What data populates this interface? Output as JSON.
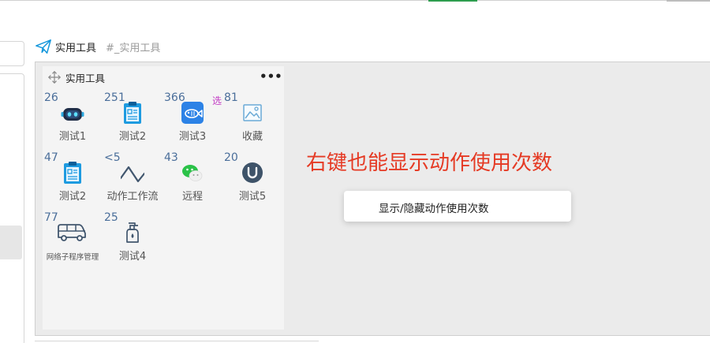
{
  "header": {
    "title": "实用工具",
    "tag": "#_实用工具",
    "icon": "paper-plane-icon"
  },
  "card": {
    "title": "实用工具",
    "more_label": "•••",
    "tiles": [
      {
        "count": "26",
        "label": "测试1",
        "icon": "robot-icon"
      },
      {
        "count": "251",
        "label": "测试2",
        "icon": "clipboard-icon"
      },
      {
        "count": "366",
        "label": "测试3",
        "icon": "fish-icon",
        "badge": "选"
      },
      {
        "count": "81",
        "label": "收藏",
        "icon": "picture-icon"
      },
      {
        "count": "47",
        "label": "测试2",
        "icon": "clipboard-icon"
      },
      {
        "count": "<5",
        "label": "动作工作流",
        "icon": "wave-icon"
      },
      {
        "count": "43",
        "label": "远程",
        "icon": "wechat-icon"
      },
      {
        "count": "20",
        "label": "测试5",
        "icon": "u-circle-icon"
      },
      {
        "count": "77",
        "label": "网络子程序管理",
        "icon": "van-icon"
      },
      {
        "count": "25",
        "label": "测试4",
        "icon": "spray-bottle-icon"
      }
    ]
  },
  "annotation": "右键也能显示动作使用次数",
  "context_menu": {
    "items": [
      "显示/隐藏动作使用次数"
    ]
  },
  "colors": {
    "accent_blue": "#1296db",
    "count_text": "#4a6e9a",
    "annotation_red": "#e53a24",
    "badge_purple": "#c23bc4"
  }
}
